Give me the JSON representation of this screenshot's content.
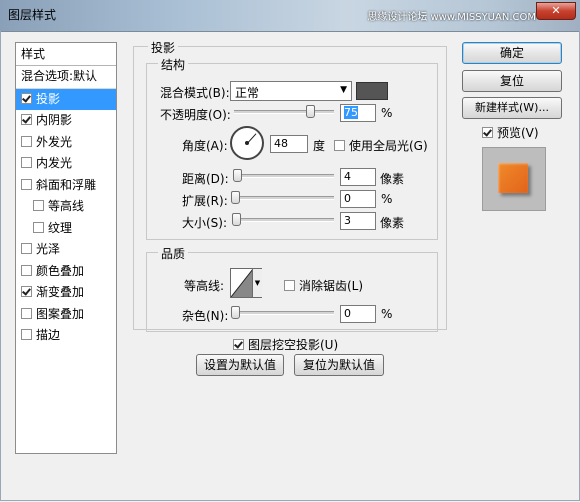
{
  "window": {
    "title": "图层样式",
    "close_symbol": "✕",
    "watermark": "思缘设计论坛 www.MISSYUAN.COM"
  },
  "styles_list": {
    "header": "样式",
    "blend_options": "混合选项:默认",
    "items": [
      {
        "label": "投影",
        "checked": true,
        "selected": true,
        "sub": false
      },
      {
        "label": "内阴影",
        "checked": true,
        "selected": false,
        "sub": false
      },
      {
        "label": "外发光",
        "checked": false,
        "selected": false,
        "sub": false
      },
      {
        "label": "内发光",
        "checked": false,
        "selected": false,
        "sub": false
      },
      {
        "label": "斜面和浮雕",
        "checked": false,
        "selected": false,
        "sub": false
      },
      {
        "label": "等高线",
        "checked": false,
        "selected": false,
        "sub": true
      },
      {
        "label": "纹理",
        "checked": false,
        "selected": false,
        "sub": true
      },
      {
        "label": "光泽",
        "checked": false,
        "selected": false,
        "sub": false
      },
      {
        "label": "颜色叠加",
        "checked": false,
        "selected": false,
        "sub": false
      },
      {
        "label": "渐变叠加",
        "checked": true,
        "selected": false,
        "sub": false
      },
      {
        "label": "图案叠加",
        "checked": false,
        "selected": false,
        "sub": false
      },
      {
        "label": "描边",
        "checked": false,
        "selected": false,
        "sub": false
      }
    ]
  },
  "drop_shadow": {
    "section_title": "投影",
    "structure": {
      "title": "结构",
      "blend_mode_label": "混合模式(B):",
      "blend_mode_value": "正常",
      "shadow_color": "#555555",
      "opacity_label": "不透明度(O):",
      "opacity_value": "75",
      "opacity_percent": 75,
      "angle_label": "角度(A):",
      "angle_value": "48",
      "angle_unit": "度",
      "global_light_label": "使用全局光(G)",
      "global_light_checked": false,
      "distance_label": "距离(D):",
      "distance_value": "4",
      "distance_unit": "像素",
      "distance_percent": 2,
      "spread_label": "扩展(R):",
      "spread_value": "0",
      "spread_percent": 0,
      "size_label": "大小(S):",
      "size_value": "3",
      "size_percent": 1,
      "percent_sign": "%"
    },
    "quality": {
      "title": "品质",
      "contour_label": "等高线:",
      "antialias_label": "消除锯齿(L)",
      "antialias_checked": false,
      "noise_label": "杂色(N):",
      "noise_value": "0",
      "noise_percent": 0,
      "percent_sign": "%"
    },
    "knockout_label": "图层挖空投影(U)",
    "knockout_checked": true,
    "make_default_button": "设置为默认值",
    "reset_default_button": "复位为默认值"
  },
  "right_panel": {
    "ok_button": "确定",
    "reset_button": "复位",
    "new_style_button": "新建样式(W)...",
    "preview_label": "预览(V)",
    "preview_checked": true,
    "preview_color": "#ee7d24"
  }
}
